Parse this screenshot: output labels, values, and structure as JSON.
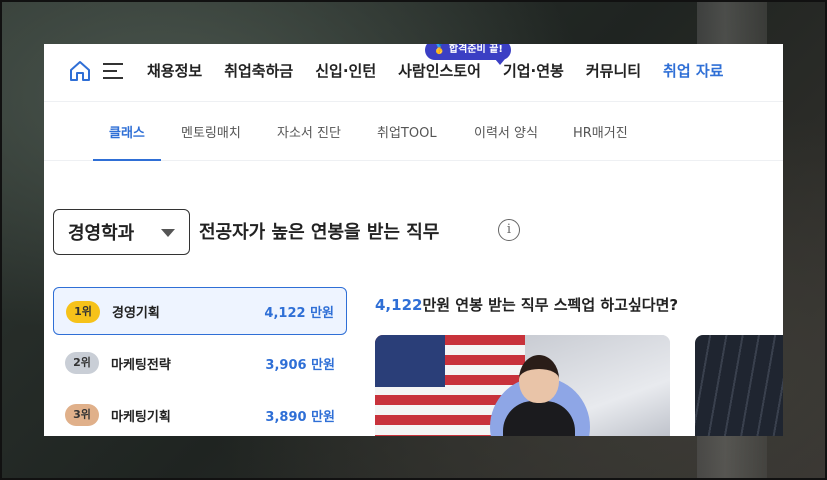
{
  "topnav": {
    "items": [
      "채용정보",
      "취업축하금",
      "신입·인턴",
      "사람인스토어",
      "기업·연봉",
      "커뮤니티",
      "취업 자료"
    ],
    "promo_badge": "🥇 합격준비 끝!"
  },
  "subnav": {
    "tabs": [
      "클래스",
      "멘토링매치",
      "자소서 진단",
      "취업TOOL",
      "이력서 양식",
      "HR매거진"
    ],
    "active_index": 0
  },
  "dept_selector": {
    "selected": "경영학과"
  },
  "headline": "전공자가 높은 연봉을 받는 직무",
  "info_icon_glyph": "i",
  "rankings": [
    {
      "rank": "1위",
      "name": "경영기획",
      "salary": "4,122 만원"
    },
    {
      "rank": "2위",
      "name": "마케팅전략",
      "salary": "3,906 만원"
    },
    {
      "rank": "3위",
      "name": "마케팅기획",
      "salary": "3,890 만원"
    }
  ],
  "panel": {
    "salary_highlight": "4,122",
    "title_rest": "만원 연봉 받는 직무 스펙업 하고싶다면?"
  },
  "colors": {
    "accent": "#2f6fd6",
    "rank1": "#f6c21a",
    "rank2": "#c9ced6",
    "rank3": "#e0b08a"
  }
}
